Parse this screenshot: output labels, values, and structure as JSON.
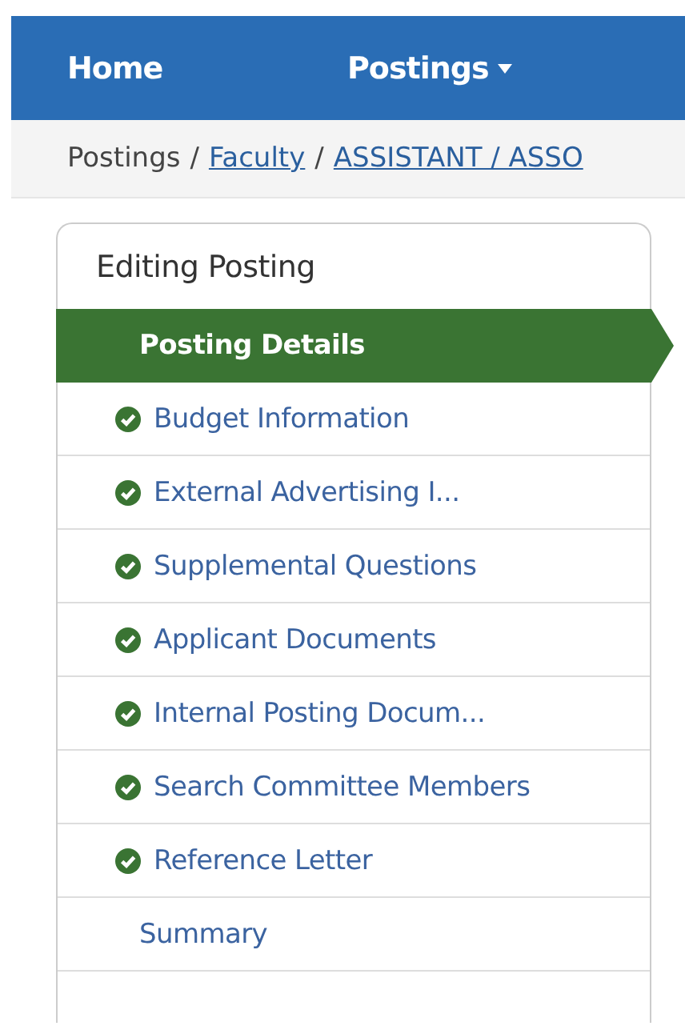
{
  "nav": {
    "items": [
      {
        "label": "Home",
        "dropdown": false
      },
      {
        "label": "Postings",
        "dropdown": true
      }
    ]
  },
  "breadcrumb": [
    {
      "label": "Postings",
      "link": false
    },
    {
      "separator": "/",
      "label": "Faculty",
      "link": true
    },
    {
      "separator": "/",
      "label": "ASSISTANT / ASSO",
      "link": true
    }
  ],
  "panel": {
    "title": "Editing Posting",
    "items": [
      {
        "label": "Posting Details",
        "selected": true,
        "completed": false
      },
      {
        "label": "Budget Information",
        "selected": false,
        "completed": true
      },
      {
        "label": "External Advertising I...",
        "selected": false,
        "completed": true
      },
      {
        "label": "Supplemental Questions",
        "selected": false,
        "completed": true
      },
      {
        "label": "Applicant Documents",
        "selected": false,
        "completed": true
      },
      {
        "label": "Internal Posting Docum...",
        "selected": false,
        "completed": true
      },
      {
        "label": "Search Committee Members",
        "selected": false,
        "completed": true
      },
      {
        "label": "Reference Letter",
        "selected": false,
        "completed": true
      },
      {
        "label": "Summary",
        "selected": false,
        "completed": false
      }
    ]
  }
}
